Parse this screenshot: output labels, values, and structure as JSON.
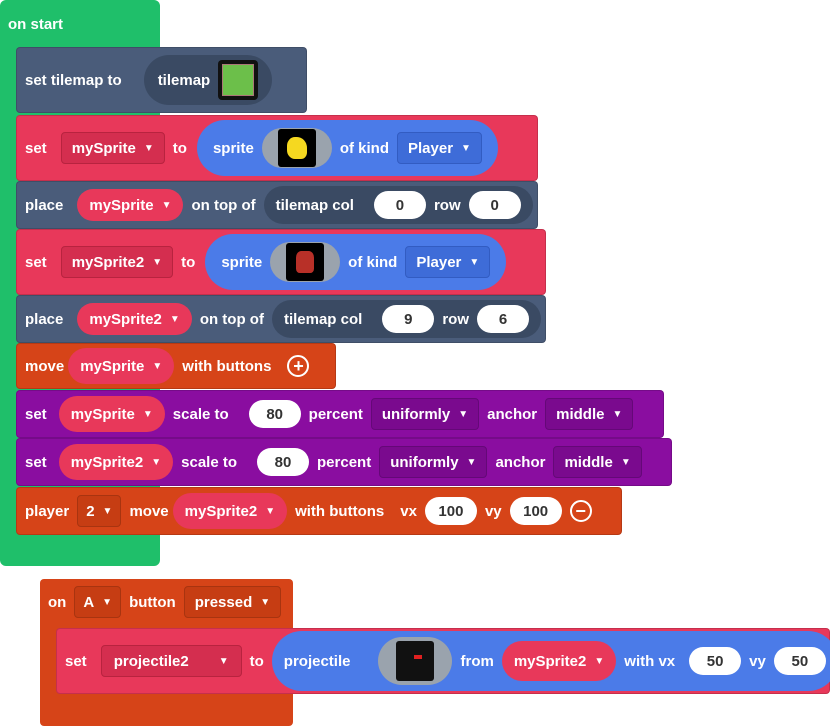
{
  "colors": {
    "event_green": "#1fbf6a",
    "tilemap_blue": "#4a5c7a",
    "sprite_red": "#e8385a",
    "sprite_blue": "#4b7be8",
    "controller_orange": "#d64418",
    "scaling_purple": "#8a0da0"
  },
  "on_start": {
    "label": "on start"
  },
  "set_tilemap": {
    "set_label": "set tilemap to",
    "value_label": "tilemap"
  },
  "set_sprite1": {
    "set": "set",
    "var": "mySprite",
    "to": "to",
    "sprite": "sprite",
    "of_kind": "of kind",
    "kind": "Player"
  },
  "place1": {
    "place": "place",
    "var": "mySprite",
    "on_top_of": "on top of",
    "tilemap_col": "tilemap col",
    "col": "0",
    "row_label": "row",
    "row": "0"
  },
  "set_sprite2": {
    "set": "set",
    "var": "mySprite2",
    "to": "to",
    "sprite": "sprite",
    "of_kind": "of kind",
    "kind": "Player"
  },
  "place2": {
    "place": "place",
    "var": "mySprite2",
    "on_top_of": "on top of",
    "tilemap_col": "tilemap col",
    "col": "9",
    "row_label": "row",
    "row": "6"
  },
  "move1": {
    "move": "move",
    "var": "mySprite",
    "with_buttons": "with buttons",
    "expand_icon": "plus-icon"
  },
  "scale1": {
    "set": "set",
    "var": "mySprite",
    "scale_to": "scale to",
    "value": "80",
    "percent": "percent",
    "mode": "uniformly",
    "anchor": "anchor",
    "anchor_value": "middle"
  },
  "scale2": {
    "set": "set",
    "var": "mySprite2",
    "scale_to": "scale to",
    "value": "80",
    "percent": "percent",
    "mode": "uniformly",
    "anchor": "anchor",
    "anchor_value": "middle"
  },
  "move2": {
    "player": "player",
    "player_num": "2",
    "move": "move",
    "var": "mySprite2",
    "with_buttons": "with buttons",
    "vx_label": "vx",
    "vx": "100",
    "vy_label": "vy",
    "vy": "100",
    "collapse_icon": "minus-icon"
  },
  "on_button": {
    "on": "on",
    "button_name": "A",
    "button": "button",
    "event": "pressed"
  },
  "set_projectile": {
    "set": "set",
    "var": "projectile2",
    "to": "to",
    "projectile": "projectile",
    "from": "from",
    "source": "mySprite2",
    "with_vx": "with vx",
    "vx": "50",
    "vy_label": "vy",
    "vy": "50"
  }
}
